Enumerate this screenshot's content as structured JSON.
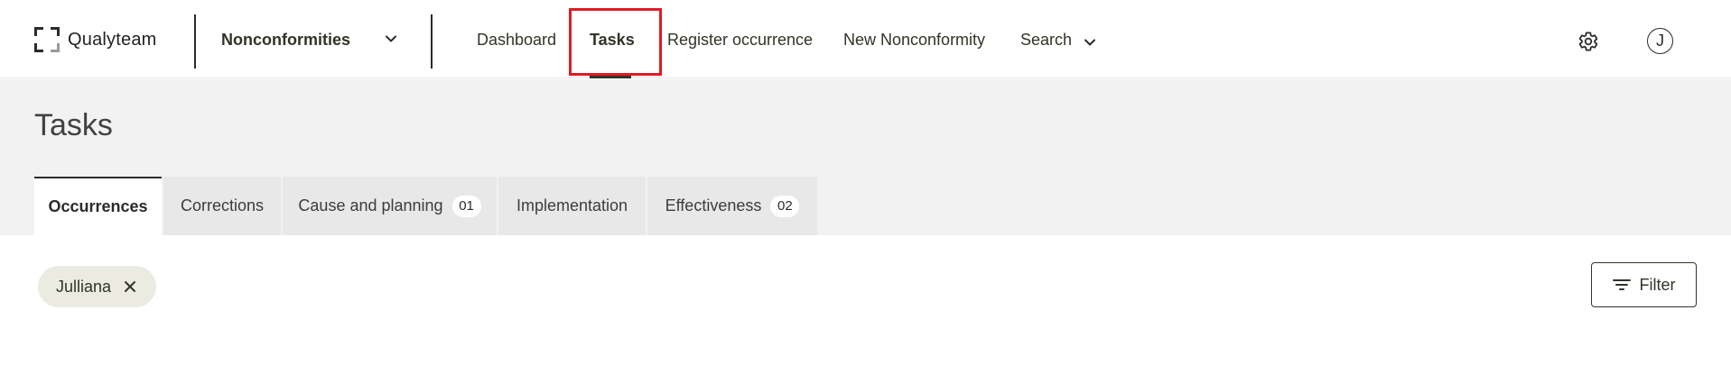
{
  "brand": {
    "name": "Qualyteam"
  },
  "module_select": {
    "label": "Nonconformities"
  },
  "nav": {
    "items": [
      {
        "label": "Dashboard",
        "active": false
      },
      {
        "label": "Tasks",
        "active": true
      },
      {
        "label": "Register occurrence",
        "active": false
      },
      {
        "label": "New Nonconformity",
        "active": false
      },
      {
        "label": "Search",
        "active": false,
        "has_dropdown": true
      }
    ]
  },
  "header_actions": {
    "settings_icon": "gear-icon",
    "avatar_initial": "J"
  },
  "page": {
    "title": "Tasks"
  },
  "tabs": [
    {
      "label": "Occurrences",
      "active": true,
      "badge": ""
    },
    {
      "label": "Corrections",
      "active": false,
      "badge": ""
    },
    {
      "label": "Cause and planning",
      "active": false,
      "badge": "01"
    },
    {
      "label": "Implementation",
      "active": false,
      "badge": ""
    },
    {
      "label": "Effectiveness",
      "active": false,
      "badge": "02"
    }
  ],
  "filters": {
    "chips": [
      {
        "label": "Julliana"
      }
    ],
    "filter_button_label": "Filter"
  },
  "colors": {
    "accent_text": "#2f3528",
    "highlight": "#e01b24",
    "header_band": "#f2f2f2",
    "chip_bg": "#ecebe2"
  }
}
